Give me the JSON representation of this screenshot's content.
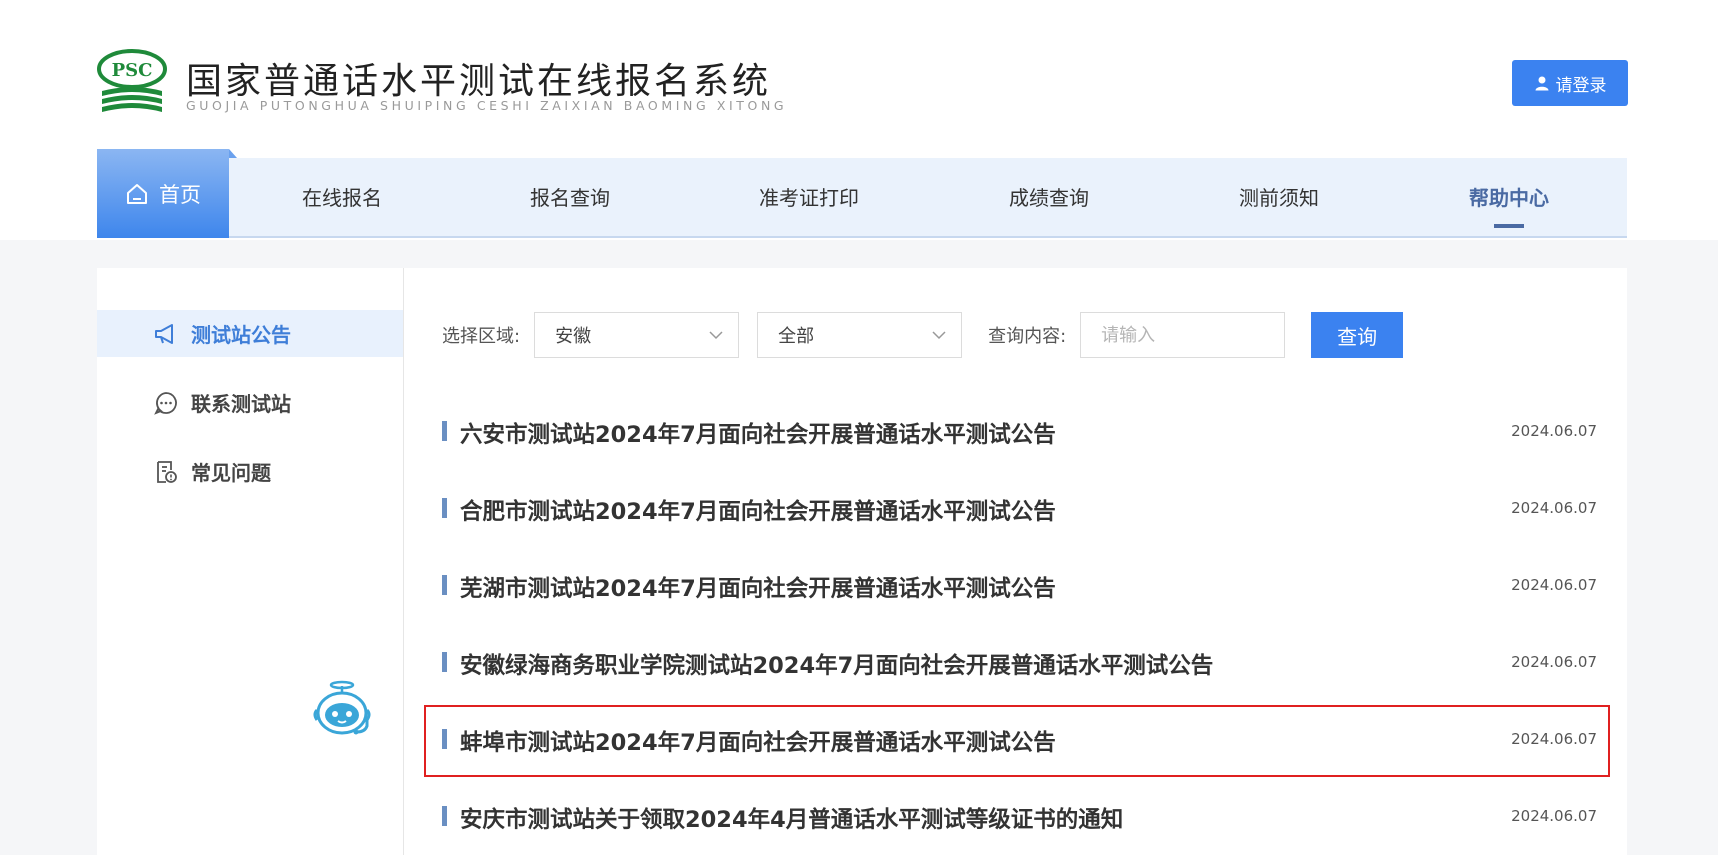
{
  "header": {
    "title": "国家普通话水平测试在线报名系统",
    "subtitle": "GUOJIA PUTONGHUA SHUIPING CESHI ZAIXIAN BAOMING XITONG",
    "logo_text": "PSC",
    "login_label": "请登录"
  },
  "nav": {
    "home": "首页",
    "items": [
      "在线报名",
      "报名查询",
      "准考证打印",
      "成绩查询",
      "测前须知",
      "帮助中心"
    ],
    "active": "帮助中心"
  },
  "sidebar": {
    "items": [
      {
        "label": "测试站公告",
        "icon": "megaphone-icon",
        "active": true
      },
      {
        "label": "联系测试站",
        "icon": "chat-bubble-icon",
        "active": false
      },
      {
        "label": "常见问题",
        "icon": "faq-document-icon",
        "active": false
      }
    ]
  },
  "filters": {
    "region_label": "选择区域:",
    "region_value": "安徽",
    "scope_value": "全部",
    "query_label": "查询内容:",
    "query_placeholder": "请输入",
    "query_button": "查询"
  },
  "announcements": [
    {
      "title": "六安市测试站2024年7月面向社会开展普通话水平测试公告",
      "date": "2024.06.07"
    },
    {
      "title": "合肥市测试站2024年7月面向社会开展普通话水平测试公告",
      "date": "2024.06.07"
    },
    {
      "title": "芜湖市测试站2024年7月面向社会开展普通话水平测试公告",
      "date": "2024.06.07"
    },
    {
      "title": "安徽绿海商务职业学院测试站2024年7月面向社会开展普通话水平测试公告",
      "date": "2024.06.07"
    },
    {
      "title": "蚌埠市测试站2024年7月面向社会开展普通话水平测试公告",
      "date": "2024.06.07",
      "highlighted": true
    },
    {
      "title": "安庆市测试站关于领取2024年4月普通话水平测试等级证书的通知",
      "date": "2024.06.07"
    }
  ],
  "colors": {
    "primary": "#3b82f0",
    "nav_bg": "#eaf2fc",
    "active_nav": "#4a6aa3",
    "logo_green": "#1f8a3a",
    "highlight_border": "#e02020"
  }
}
